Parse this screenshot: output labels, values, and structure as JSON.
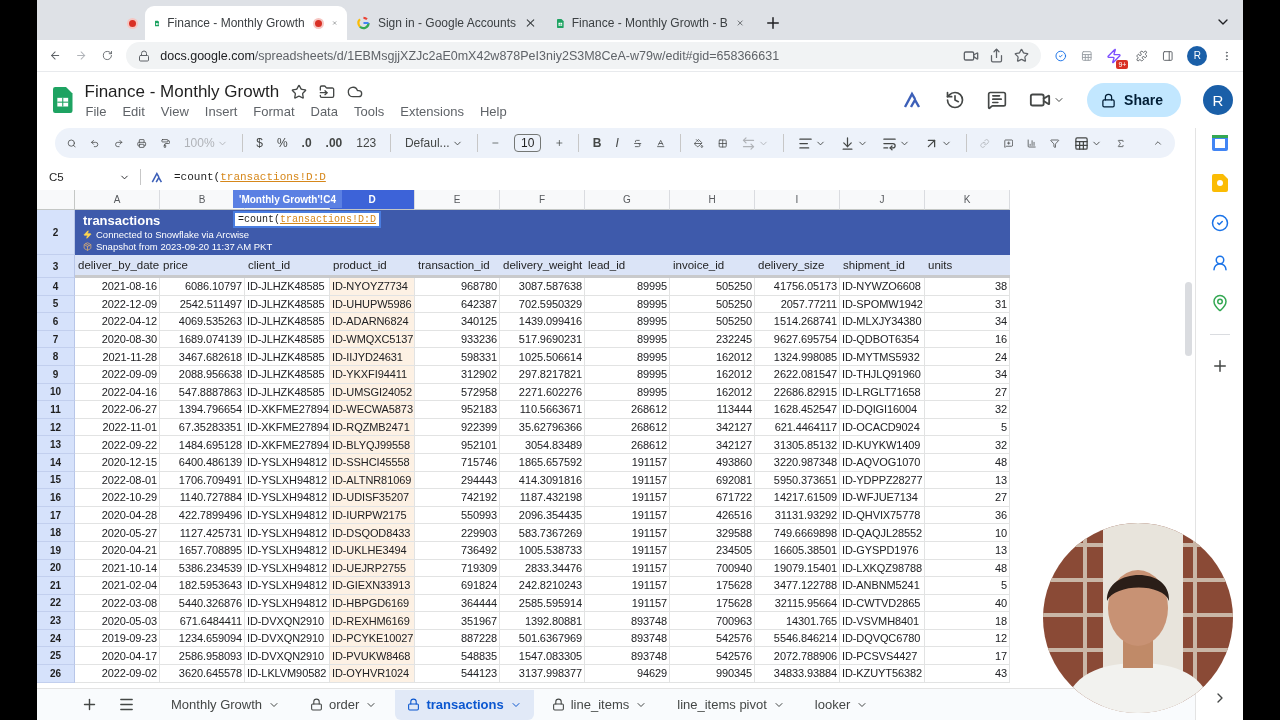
{
  "browser": {
    "tabs": [
      {
        "kind": "recording",
        "recording": true,
        "selected": false
      },
      {
        "kind": "sheets",
        "title": "Finance - Monthly Growth",
        "recording": true,
        "selected": true
      },
      {
        "kind": "google",
        "title": "Sign in - Google Accounts",
        "recording": false,
        "selected": false
      },
      {
        "kind": "sheets",
        "title": "Finance - Monthly Growth - B",
        "recording": false,
        "selected": false
      }
    ],
    "url": {
      "host": "docs.google.com",
      "path": "/spreadsheets/d/1EBMsgjjXZJc2aE0mX42w878PeI3niy2S3M8CeA-w79w/edit#gid=658366631"
    },
    "extension_badge": "9+",
    "profile_initial": "R"
  },
  "document": {
    "title": "Finance - Monthly Growth",
    "menu": [
      "File",
      "Edit",
      "View",
      "Insert",
      "Format",
      "Data",
      "Tools",
      "Extensions",
      "Help"
    ],
    "share": "Share",
    "avatar_initial": "R"
  },
  "toolbar": {
    "zoom": "100%",
    "currency": "$",
    "percent": "%",
    "decimal_less": ".0",
    "decimal_more": ".00",
    "number_format": "123",
    "font": "Defaul...",
    "font_size": "10",
    "bold": "B",
    "italic": "I"
  },
  "formula_bar": {
    "name_box": "C5",
    "prefix": "=count(",
    "reference": "transactions!D:D"
  },
  "formula_popup": {
    "tag": "'Monthly Growth'!C4",
    "prefix": "=count(",
    "reference": "transactions!D:D"
  },
  "columns": [
    {
      "letter": "A",
      "header": "deliver_by_date",
      "kind": "number",
      "selected": false
    },
    {
      "letter": "B",
      "header": "price",
      "kind": "number",
      "selected": false
    },
    {
      "header": "client_id",
      "kind": "text",
      "selected": false
    },
    {
      "letter": "D",
      "header": "product_id",
      "kind": "text",
      "selected": true
    },
    {
      "letter": "E",
      "header": "transaction_id",
      "kind": "number",
      "selected": false
    },
    {
      "letter": "F",
      "header": "delivery_weight",
      "kind": "number",
      "selected": false
    },
    {
      "letter": "G",
      "header": "lead_id",
      "kind": "number",
      "selected": false
    },
    {
      "letter": "H",
      "header": "invoice_id",
      "kind": "number",
      "selected": false
    },
    {
      "letter": "I",
      "header": "delivery_size",
      "kind": "number",
      "selected": false
    },
    {
      "letter": "J",
      "header": "shipment_id",
      "kind": "text",
      "selected": false
    },
    {
      "letter": "K",
      "header": "units",
      "kind": "number",
      "selected": false
    }
  ],
  "banner": {
    "row_number": "2",
    "title": "transactions",
    "connection": "Connected to Snowflake via Arcwise",
    "snapshot": "Snapshot from 2023-09-20 11:37 AM PKT"
  },
  "header_row_number": "3",
  "rows": [
    {
      "number": "4",
      "cells": [
        "2021-08-16",
        "6086.10797",
        "ID-JLHZK48585",
        "ID-NYOYZ7734",
        "968780",
        "3087.587638",
        "89995",
        "505250",
        "41756.05173",
        "ID-NYWZO6608",
        "38"
      ]
    },
    {
      "number": "5",
      "cells": [
        "2022-12-09",
        "2542.511497",
        "ID-JLHZK48585",
        "ID-UHUPW5986",
        "642387",
        "702.5950329",
        "89995",
        "505250",
        "2057.77211",
        "ID-SPOMW1942",
        "31"
      ]
    },
    {
      "number": "6",
      "cells": [
        "2022-04-12",
        "4069.535263",
        "ID-JLHZK48585",
        "ID-ADARN6824",
        "340125",
        "1439.099416",
        "89995",
        "505250",
        "1514.268741",
        "ID-MLXJY34380",
        "34"
      ]
    },
    {
      "number": "7",
      "cells": [
        "2020-08-30",
        "1689.074139",
        "ID-JLHZK48585",
        "ID-WMQXC5137",
        "933236",
        "517.9690231",
        "89995",
        "232245",
        "9627.695754",
        "ID-QDBOT6354",
        "16"
      ]
    },
    {
      "number": "8",
      "cells": [
        "2021-11-28",
        "3467.682618",
        "ID-JLHZK48585",
        "ID-IIJYD24631",
        "598331",
        "1025.506614",
        "89995",
        "162012",
        "1324.998085",
        "ID-MYTMS5932",
        "24"
      ]
    },
    {
      "number": "9",
      "cells": [
        "2022-09-09",
        "2088.956638",
        "ID-JLHZK48585",
        "ID-YKXFI94411",
        "312902",
        "297.8217821",
        "89995",
        "162012",
        "2622.081547",
        "ID-THJLQ91960",
        "34"
      ]
    },
    {
      "number": "10",
      "cells": [
        "2022-04-16",
        "547.8887863",
        "ID-JLHZK48585",
        "ID-UMSGI24052",
        "572958",
        "2271.602276",
        "89995",
        "162012",
        "22686.82915",
        "ID-LRGLT71658",
        "27"
      ]
    },
    {
      "number": "11",
      "cells": [
        "2022-06-27",
        "1394.796654",
        "ID-XKFME27894",
        "ID-WECWA5873",
        "952183",
        "110.5663671",
        "268612",
        "113444",
        "1628.452547",
        "ID-DQIGI16004",
        "32"
      ]
    },
    {
      "number": "12",
      "cells": [
        "2022-11-01",
        "67.35283351",
        "ID-XKFME27894",
        "ID-RQZMB2471",
        "922399",
        "35.62796366",
        "268612",
        "342127",
        "621.4464117",
        "ID-OCACD9024",
        "5"
      ]
    },
    {
      "number": "13",
      "cells": [
        "2022-09-22",
        "1484.695128",
        "ID-XKFME27894",
        "ID-BLYQJ99558",
        "952101",
        "3054.83489",
        "268612",
        "342127",
        "31305.85132",
        "ID-KUYKW1409",
        "32"
      ]
    },
    {
      "number": "14",
      "cells": [
        "2020-12-15",
        "6400.486139",
        "ID-YSLXH94812",
        "ID-SSHCI45558",
        "715746",
        "1865.657592",
        "191157",
        "493860",
        "3220.987348",
        "ID-AQVOG1070",
        "48"
      ]
    },
    {
      "number": "15",
      "cells": [
        "2022-08-01",
        "1706.709491",
        "ID-YSLXH94812",
        "ID-ALTNR81069",
        "294443",
        "414.3091816",
        "191157",
        "692081",
        "5950.373651",
        "ID-YDPPZ28277",
        "13"
      ]
    },
    {
      "number": "16",
      "cells": [
        "2022-10-29",
        "1140.727884",
        "ID-YSLXH94812",
        "ID-UDISF35207",
        "742192",
        "1187.432198",
        "191157",
        "671722",
        "14217.61509",
        "ID-WFJUE7134",
        "27"
      ]
    },
    {
      "number": "17",
      "cells": [
        "2020-04-28",
        "422.7899496",
        "ID-YSLXH94812",
        "ID-IURPW2175",
        "550993",
        "2096.354435",
        "191157",
        "426516",
        "31131.93292",
        "ID-QHVIX75778",
        "36"
      ]
    },
    {
      "number": "18",
      "cells": [
        "2020-05-27",
        "1127.425731",
        "ID-YSLXH94812",
        "ID-DSQOD8433",
        "229903",
        "583.7367269",
        "191157",
        "329588",
        "749.6669898",
        "ID-QAQJL28552",
        "10"
      ]
    },
    {
      "number": "19",
      "cells": [
        "2020-04-21",
        "1657.708895",
        "ID-YSLXH94812",
        "ID-UKLHE3494",
        "736492",
        "1005.538733",
        "191157",
        "234505",
        "16605.38501",
        "ID-GYSPD1976",
        "13"
      ]
    },
    {
      "number": "20",
      "cells": [
        "2021-10-14",
        "5386.234539",
        "ID-YSLXH94812",
        "ID-UEJRP2755",
        "719309",
        "2833.34476",
        "191157",
        "700940",
        "19079.15401",
        "ID-LXKQZ98788",
        "48"
      ]
    },
    {
      "number": "21",
      "cells": [
        "2021-02-04",
        "182.5953643",
        "ID-YSLXH94812",
        "ID-GIEXN33913",
        "691824",
        "242.8210243",
        "191157",
        "175628",
        "3477.122788",
        "ID-ANBNM5241",
        "5"
      ]
    },
    {
      "number": "22",
      "cells": [
        "2022-03-08",
        "5440.326876",
        "ID-YSLXH94812",
        "ID-HBPGD6169",
        "364444",
        "2585.595914",
        "191157",
        "175628",
        "32115.95664",
        "ID-CWTVD2865",
        "40"
      ]
    },
    {
      "number": "23",
      "cells": [
        "2020-05-03",
        "671.6484411",
        "ID-DVXQN2910",
        "ID-REXHM6169",
        "351967",
        "1392.80881",
        "893748",
        "700963",
        "14301.765",
        "ID-VSVMH8401",
        "18"
      ]
    },
    {
      "number": "24",
      "cells": [
        "2019-09-23",
        "1234.659094",
        "ID-DVXQN2910",
        "ID-PCYKE10027",
        "887228",
        "501.6367969",
        "893748",
        "542576",
        "5546.846214",
        "ID-DQVQC6780",
        "12"
      ]
    },
    {
      "number": "25",
      "cells": [
        "2020-04-17",
        "2586.958093",
        "ID-DVXQN2910",
        "ID-PVUKW8468",
        "548835",
        "1547.083305",
        "893748",
        "542576",
        "2072.788906",
        "ID-PCSVS4427",
        "17"
      ]
    },
    {
      "number": "26",
      "cells": [
        "2022-09-02",
        "3620.645578",
        "ID-LKLVM90582",
        "ID-OYHVR1024",
        "544123",
        "3137.998377",
        "94629",
        "990345",
        "34833.93884",
        "ID-KZUYT56382",
        "43"
      ]
    }
  ],
  "sheet_tabs": [
    {
      "label": "Monthly Growth",
      "locked": false,
      "selected": false
    },
    {
      "label": "order",
      "locked": true,
      "selected": false
    },
    {
      "label": "transactions",
      "locked": true,
      "selected": true
    },
    {
      "label": "line_items",
      "locked": true,
      "selected": false
    },
    {
      "label": "line_items pivot",
      "locked": false,
      "selected": false
    },
    {
      "label": "looker",
      "locked": false,
      "selected": false
    }
  ]
}
